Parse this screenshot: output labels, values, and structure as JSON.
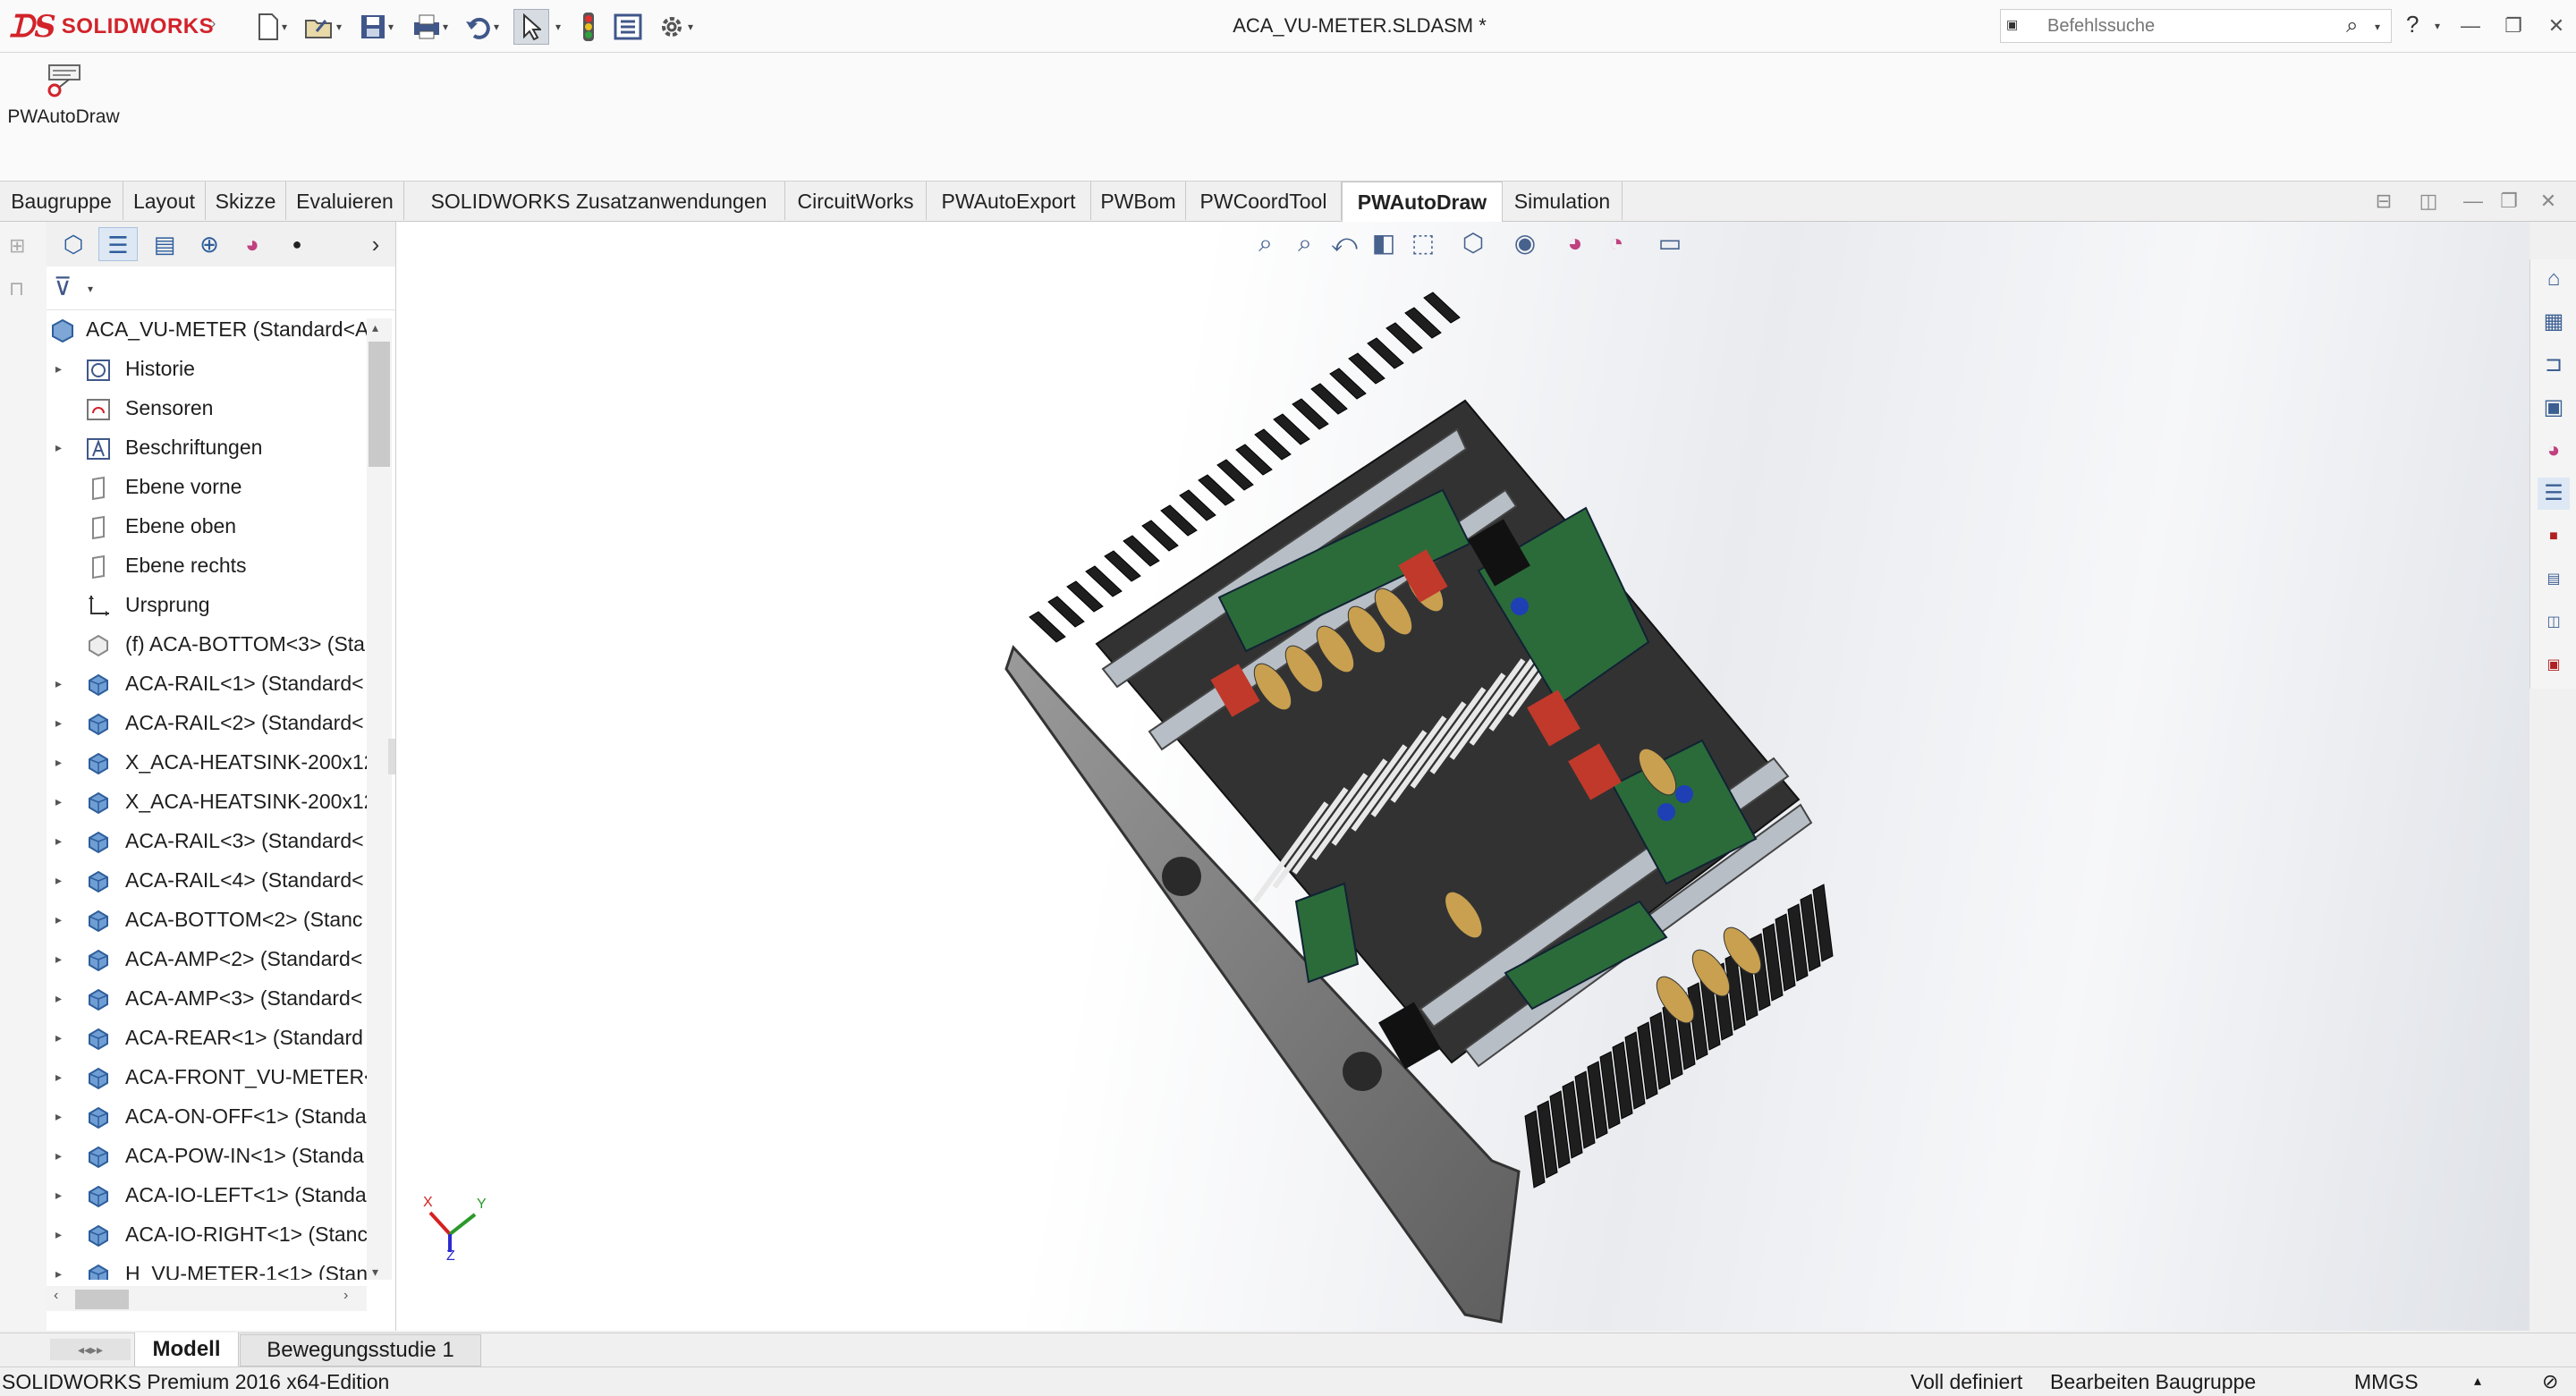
{
  "app": {
    "title": "ACA_VU-METER.SLDASM *",
    "brand": "SOLIDWORKS"
  },
  "toolbar": {
    "icons": [
      "new-icon",
      "open-icon",
      "save-icon",
      "print-icon",
      "undo-icon",
      "select-icon",
      "rebuild-icon",
      "file-properties-icon",
      "options-icon"
    ]
  },
  "search": {
    "placeholder": "Befehlssuche"
  },
  "command_manager": {
    "pwautodraw_label": "PWAutoDraw"
  },
  "tabs": [
    {
      "label": "Baugruppe"
    },
    {
      "label": "Layout"
    },
    {
      "label": "Skizze"
    },
    {
      "label": "Evaluieren"
    },
    {
      "label": "SOLIDWORKS Zusatzanwendungen"
    },
    {
      "label": "CircuitWorks"
    },
    {
      "label": "PWAutoExport"
    },
    {
      "label": "PWBom"
    },
    {
      "label": "PWCoordTool"
    },
    {
      "label": "PWAutoDraw",
      "active": true
    },
    {
      "label": "Simulation"
    }
  ],
  "tree": {
    "root": "ACA_VU-METER  (Standard<A",
    "items": [
      {
        "label": "Historie"
      },
      {
        "label": "Sensoren"
      },
      {
        "label": "Beschriftungen"
      },
      {
        "label": "Ebene vorne"
      },
      {
        "label": "Ebene oben"
      },
      {
        "label": "Ebene rechts"
      },
      {
        "label": "Ursprung"
      },
      {
        "label": "(f) ACA-BOTTOM<3> (Sta"
      },
      {
        "label": "ACA-RAIL<1> (Standard<"
      },
      {
        "label": "ACA-RAIL<2> (Standard<"
      },
      {
        "label": "X_ACA-HEATSINK-200x12"
      },
      {
        "label": "X_ACA-HEATSINK-200x12"
      },
      {
        "label": "ACA-RAIL<3> (Standard<"
      },
      {
        "label": "ACA-RAIL<4> (Standard<"
      },
      {
        "label": "ACA-BOTTOM<2> (Stanc"
      },
      {
        "label": "ACA-AMP<2> (Standard<"
      },
      {
        "label": "ACA-AMP<3> (Standard<"
      },
      {
        "label": "ACA-REAR<1> (Standard"
      },
      {
        "label": "ACA-FRONT_VU-METER<"
      },
      {
        "label": "ACA-ON-OFF<1> (Standa"
      },
      {
        "label": "ACA-POW-IN<1> (Standa"
      },
      {
        "label": "ACA-IO-LEFT<1> (Standa"
      },
      {
        "label": "ACA-IO-RIGHT<1> (Stanc"
      },
      {
        "label": "H_VU-METER-1<1> (Stan"
      }
    ]
  },
  "triad": {
    "x": "X",
    "y": "Y",
    "z": "Z"
  },
  "bottom_tabs": {
    "model": "Modell",
    "motion": "Bewegungsstudie 1"
  },
  "status": {
    "edition": "SOLIDWORKS Premium 2016 x64-Edition",
    "defined": "Voll definiert",
    "editing": "Bearbeiten Baugruppe",
    "units": "MMGS"
  },
  "colors": {
    "accent": "#d2232a",
    "heatsink": "#1e1e1e",
    "pcb": "#2b6b3a",
    "capacitor": "#c0392b"
  }
}
